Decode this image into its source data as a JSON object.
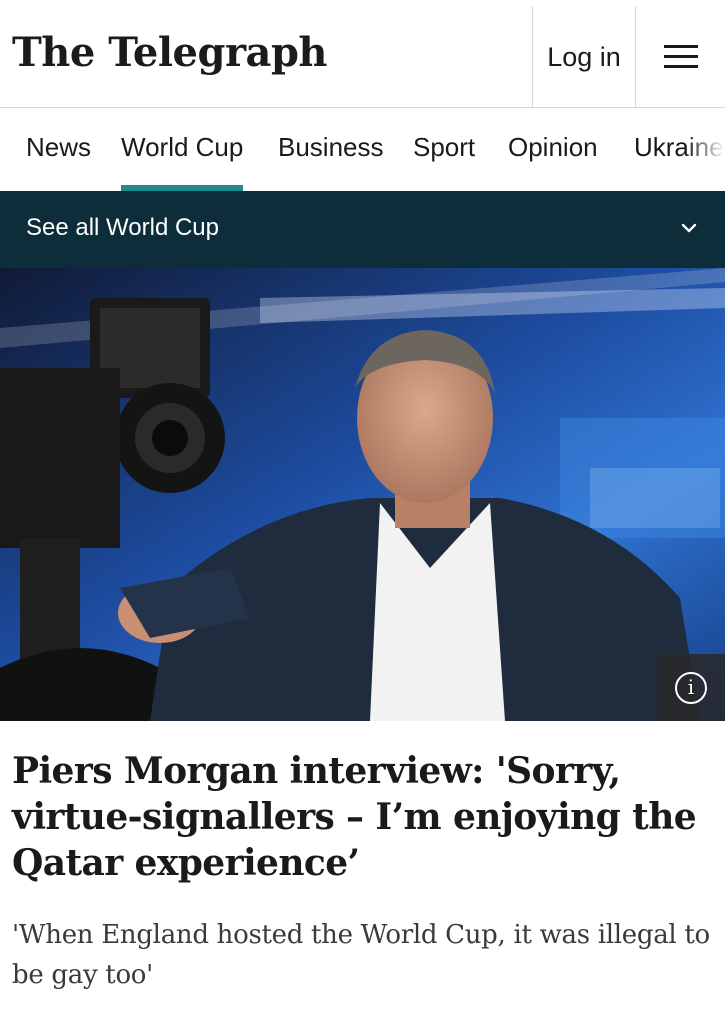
{
  "header": {
    "logo_text": "The Telegraph",
    "login_label": "Log in",
    "menu_icon": "hamburger-menu-icon"
  },
  "nav": {
    "items": [
      {
        "label": "News",
        "active": false
      },
      {
        "label": "World Cup",
        "active": true
      },
      {
        "label": "Business",
        "active": false
      },
      {
        "label": "Sport",
        "active": false
      },
      {
        "label": "Opinion",
        "active": false
      },
      {
        "label": "Ukraine",
        "active": false
      }
    ],
    "active_color": "#1e8c8c"
  },
  "section_bar": {
    "label": "See all World Cup",
    "icon": "chevron-down-icon",
    "background": "#0d2d3a"
  },
  "hero": {
    "image": "photo of man in suit beside TV camera in blue studio",
    "info_icon": "info-icon",
    "info_glyph": "i"
  },
  "article": {
    "headline": "Piers Morgan interview: 'Sorry, virtue-signallers – I’m enjoying the Qatar experience’",
    "standfirst": "'When England hosted the World Cup, it was illegal to be gay too'"
  }
}
